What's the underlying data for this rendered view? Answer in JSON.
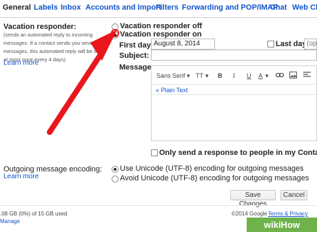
{
  "tabs": [
    "General",
    "Labels",
    "Inbox",
    "Accounts and Import",
    "Filters",
    "Forwarding and POP/IMAP",
    "Chat",
    "Web Clip"
  ],
  "vacation": {
    "title": "Vacation responder:",
    "description": "(sends an automated reply to incoming messages. If a contact sends you several messages, this automated reply will be sent at most once every 4 days)",
    "learn_more": "Learn more",
    "off_label": "Vacation responder off",
    "on_label": "Vacation responder on",
    "selected": "on",
    "first_day_label": "First day:",
    "first_day_value": "August 8, 2014",
    "last_day_label": "Last day:",
    "last_day_value": "(opti",
    "subject_label": "Subject:",
    "subject_value": "",
    "message_label": "Message:",
    "toolbar": {
      "font": "Sans Serif",
      "size_icon": "TT",
      "bold": "B",
      "italic": "I",
      "underline": "U",
      "text_color": "A"
    },
    "plain_text_link": "« Plain Text",
    "contacts_only_label": "Only send a response to people in my Contacts"
  },
  "encoding": {
    "title": "Outgoing message encoding:",
    "learn_more": "Learn more",
    "unicode_label": "Use Unicode (UTF-8) encoding for outgoing messages",
    "avoid_label": "Avoid Unicode (UTF-8) encoding for outgoing messages",
    "selected": "unicode"
  },
  "buttons": {
    "save": "Save Changes",
    "cancel": "Cancel"
  },
  "footer": {
    "storage": ".08 GB (0%) of 15 GB used",
    "manage": "Manage",
    "copyright": "©2014 Google -",
    "terms": "Terms & Privacy"
  },
  "watermark": "wikiHow",
  "colors": {
    "link": "#1155cc",
    "arrow": "#e8161d",
    "watermark": "#6eb24b"
  }
}
